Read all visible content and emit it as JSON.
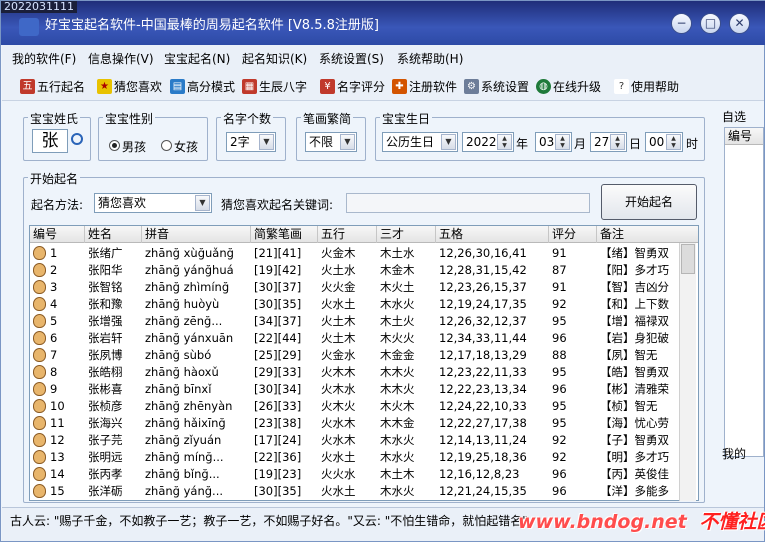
{
  "window": {
    "datetime_stamp": "2022031111",
    "title": "好宝宝起名软件-中国最棒的周易起名软件 [V8.5.8注册版]",
    "min_label": "−",
    "max_label": "□",
    "close_label": "✕"
  },
  "menus": [
    "我的软件(F)",
    "信息操作(V)",
    "宝宝起名(N)",
    "起名知识(K)",
    "系统设置(S)",
    "系统帮助(H)"
  ],
  "toolbar": [
    {
      "label": "五行起名",
      "icon": "five-elements-icon",
      "color": "#c0392b"
    },
    {
      "label": "猜您喜欢",
      "icon": "star-icon",
      "color": "#d4a800"
    },
    {
      "label": "高分模式",
      "icon": "chart-icon",
      "color": "#2a7bc8"
    },
    {
      "label": "生辰八字",
      "icon": "calendar-icon",
      "color": "#c0392b"
    },
    {
      "label": "名字评分",
      "icon": "score-icon",
      "color": "#c0392b"
    },
    {
      "label": "注册软件",
      "icon": "gift-icon",
      "color": "#d35400"
    },
    {
      "label": "系统设置",
      "icon": "settings-icon",
      "color": "#6d7d99"
    },
    {
      "label": "在线升级",
      "icon": "globe-icon",
      "color": "#1f7a3a"
    },
    {
      "label": "使用帮助",
      "icon": "help-icon",
      "color": "#b8a000"
    }
  ],
  "surname": {
    "legend": "宝宝姓氏",
    "value": "张"
  },
  "gender": {
    "legend": "宝宝性别",
    "boy": "男孩",
    "girl": "女孩",
    "selected": "男孩"
  },
  "name_count": {
    "legend": "名字个数",
    "value": "2字"
  },
  "stroke_type": {
    "legend": "笔画繁简",
    "value": "不限"
  },
  "birthday": {
    "legend": "宝宝生日",
    "calendar": "公历生日",
    "year": "2022",
    "year_unit": "年",
    "month": "03",
    "month_unit": "月",
    "day": "27",
    "day_unit": "日",
    "hour": "00",
    "hour_unit": "时"
  },
  "start_section": {
    "legend": "开始起名",
    "method_label": "起名方法:",
    "method_value": "猜您喜欢",
    "keyword_label": "猜您喜欢起名关键词:",
    "keyword_value": "",
    "start_button": "开始起名"
  },
  "right_panel": {
    "top_label": "自选",
    "col_label": "编号",
    "bottom_label": "我的"
  },
  "table": {
    "columns": [
      "编号",
      "姓名",
      "拼音",
      "简繁笔画",
      "五行",
      "三才",
      "五格",
      "评分",
      "备注"
    ],
    "rows": [
      [
        "1",
        "张绪广",
        "zhānğ xùğuǎnğ",
        "[21][41]",
        "火金木",
        "木土水",
        "12,26,30,16,41",
        "91",
        "【绪】智勇双"
      ],
      [
        "2",
        "张阳华",
        "zhānğ yánğhuá",
        "[19][42]",
        "火土水",
        "木金木",
        "12,28,31,15,42",
        "87",
        "【阳】多才巧"
      ],
      [
        "3",
        "张智铭",
        "zhānğ zhìmínğ",
        "[30][37]",
        "火火金",
        "木火土",
        "12,23,26,15,37",
        "91",
        "【智】吉凶分"
      ],
      [
        "4",
        "张和豫",
        "zhānğ huòyù",
        "[30][35]",
        "火水土",
        "木水火",
        "12,19,24,17,35",
        "92",
        "【和】上下数"
      ],
      [
        "5",
        "张增强",
        "zhānğ zēnğ...",
        "[34][37]",
        "火土木",
        "木土火",
        "12,26,32,12,37",
        "95",
        "【增】福禄双"
      ],
      [
        "6",
        "张岩轩",
        "zhānğ yánxuān",
        "[22][44]",
        "火土木",
        "木火火",
        "12,34,33,11,44",
        "96",
        "【岩】身犯破"
      ],
      [
        "7",
        "张夙博",
        "zhānğ sùbó",
        "[25][29]",
        "火金水",
        "木金金",
        "12,17,18,13,29",
        "88",
        "【夙】智无"
      ],
      [
        "8",
        "张皓栩",
        "zhānğ hàoxǔ",
        "[29][33]",
        "火木木",
        "木木火",
        "12,23,22,11,33",
        "95",
        "【皓】智勇双"
      ],
      [
        "9",
        "张彬喜",
        "zhānğ bīnxǐ",
        "[30][34]",
        "火木水",
        "木木火",
        "12,22,23,13,34",
        "96",
        "【彬】清雅荣"
      ],
      [
        "10",
        "张桢彦",
        "zhānğ zhēnyàn",
        "[26][33]",
        "火木火",
        "木火木",
        "12,24,22,10,33",
        "95",
        "【桢】智无"
      ],
      [
        "11",
        "张海兴",
        "zhānğ hǎixīnğ",
        "[23][38]",
        "火水木",
        "木木金",
        "12,22,27,17,38",
        "95",
        "【海】忧心劳"
      ],
      [
        "12",
        "张子芫",
        "zhānğ zǐyuán",
        "[17][24]",
        "火水木",
        "木水火",
        "12,14,13,11,24",
        "92",
        "【子】智勇双"
      ],
      [
        "13",
        "张明远",
        "zhānğ mínğ...",
        "[22][36]",
        "火水土",
        "木水火",
        "12,19,25,18,36",
        "92",
        "【明】多才巧"
      ],
      [
        "14",
        "张丙孝",
        "zhānğ bǐnğ...",
        "[19][23]",
        "火火水",
        "木土木",
        "12,16,12,8,23",
        "96",
        "【丙】英俊佳"
      ],
      [
        "15",
        "张洋砺",
        "zhānğ yánğ...",
        "[30][35]",
        "火水土",
        "木水火",
        "12,21,24,15,35",
        "96",
        "【洋】多能多"
      ]
    ]
  },
  "status_text": "古人云: \"赐子千金，不如教子一艺；教子一艺，不如赐子好名。\"又云: \"不怕生错命，就怕起错名\"",
  "watermark": {
    "url": "www.bndog.net",
    "site": "不懂社区"
  }
}
